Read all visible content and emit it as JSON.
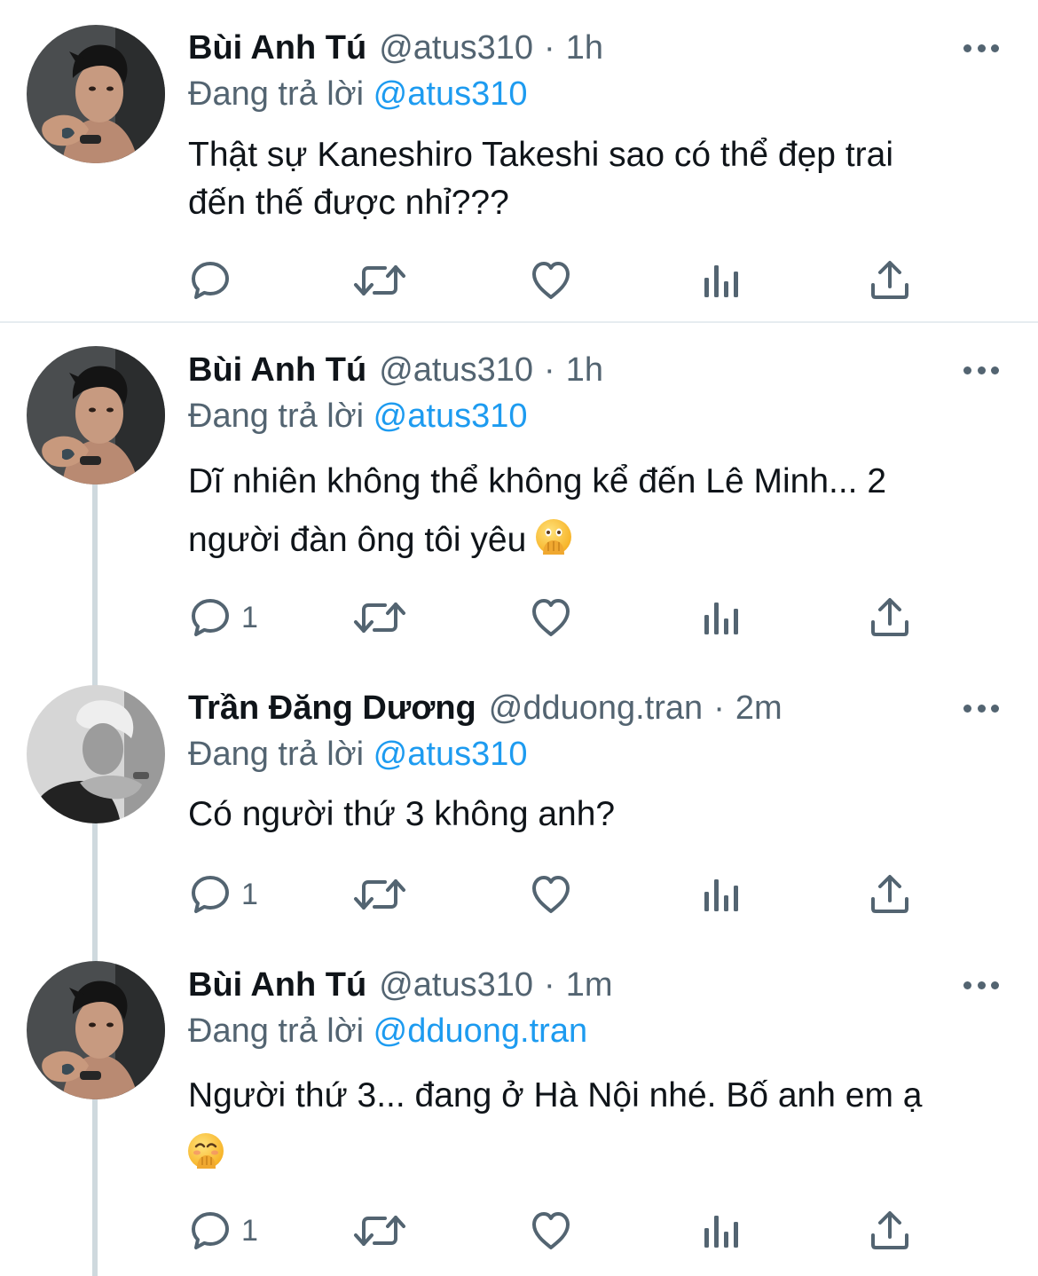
{
  "tweets": [
    {
      "name": "Bùi Anh Tú",
      "handle": "@atus310",
      "time": "1h",
      "reply_prefix": "Đang trả lời",
      "reply_to": "@atus310",
      "text_line1": "Thật sự Kaneshiro Takeshi sao có thể đẹp trai",
      "text_line2": "đến thế được nhỉ???",
      "reply_count": ""
    },
    {
      "name": "Bùi Anh Tú",
      "handle": "@atus310",
      "time": "1h",
      "reply_prefix": "Đang trả lời",
      "reply_to": "@atus310",
      "text_line1": "Dĩ nhiên không thể không kể đến Lê Minh... 2",
      "text_line2": "người đàn ông tôi yêu",
      "reply_count": "1"
    },
    {
      "name": "Trần Đăng Dương",
      "handle": "@dduong.tran",
      "time": "2m",
      "reply_prefix": "Đang trả lời",
      "reply_to": "@atus310",
      "text_line1": "Có người thứ 3 không anh?",
      "reply_count": "1"
    },
    {
      "name": "Bùi Anh Tú",
      "handle": "@atus310",
      "time": "1m",
      "reply_prefix": "Đang trả lời",
      "reply_to": "@dduong.tran",
      "text_line1": "Người thứ 3... đang ở Hà Nội nhé. Bố anh em ạ",
      "reply_count": "1"
    }
  ],
  "colors": {
    "text": "#0f1419",
    "secondary": "#536471",
    "mention": "#1d9bf0",
    "thread_line": "#cfd9de"
  },
  "icons": [
    "reply-icon",
    "retweet-icon",
    "like-icon",
    "analytics-icon",
    "share-icon",
    "more-icon"
  ],
  "emojis": [
    "face-with-open-eyes-and-hand-over-mouth",
    "face-with-hand-over-mouth"
  ]
}
